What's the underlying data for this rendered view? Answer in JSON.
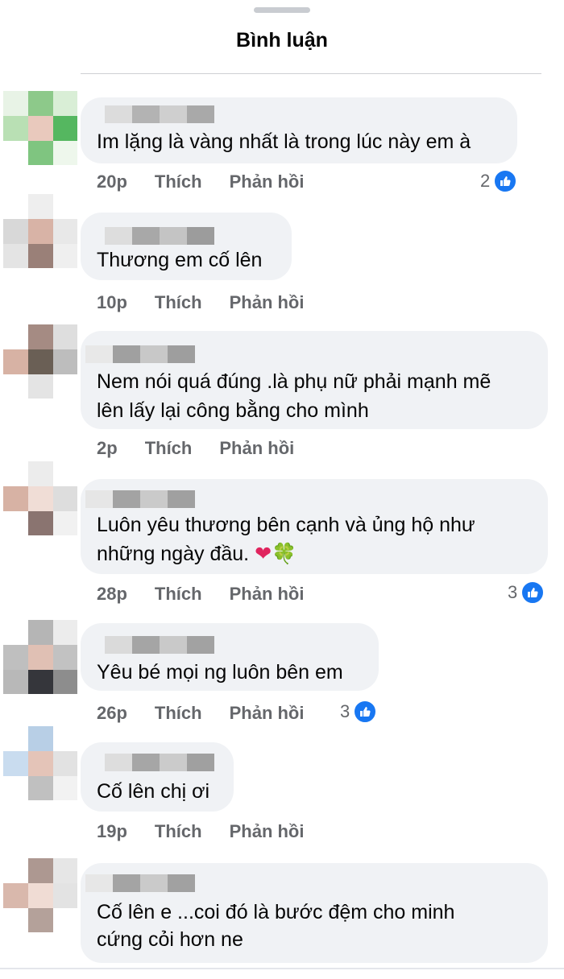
{
  "header": {
    "title": "Bình luận"
  },
  "colors": {
    "bubble": "#f0f2f5",
    "meta_text": "#65676b",
    "like_blue": "#1877f2",
    "divider": "#ced0d4"
  },
  "actions": {
    "like": "Thích",
    "reply": "Phản hồi"
  },
  "icons": {
    "like": "like-thumbs-up-icon"
  },
  "comments": [
    {
      "lines": [
        "Im lặng là vàng nhất là trong lúc này em à"
      ],
      "time": "20p",
      "reactions": "2"
    },
    {
      "lines": [
        "Thương em cố lên"
      ],
      "time": "10p"
    },
    {
      "lines": [
        "Nem nói quá đúng .là phụ nữ phải mạnh mẽ",
        "lên lấy lại công bằng cho mình"
      ],
      "time": "2p"
    },
    {
      "lines": [
        "Luôn yêu thương bên cạnh và ủng hộ như",
        "những ngày đầu."
      ],
      "emoji": [
        "❤",
        "🍀"
      ],
      "time": "28p",
      "reactions": "3"
    },
    {
      "lines": [
        "Yêu bé mọi ng luôn bên em"
      ],
      "time": "26p",
      "reactions": "3"
    },
    {
      "lines": [
        "Cố lên chị ơi"
      ],
      "time": "19p"
    },
    {
      "lines": [
        "Cố lên e ...coi đó là bước đệm cho minh",
        "cứng cỏi hơn ne"
      ]
    }
  ]
}
